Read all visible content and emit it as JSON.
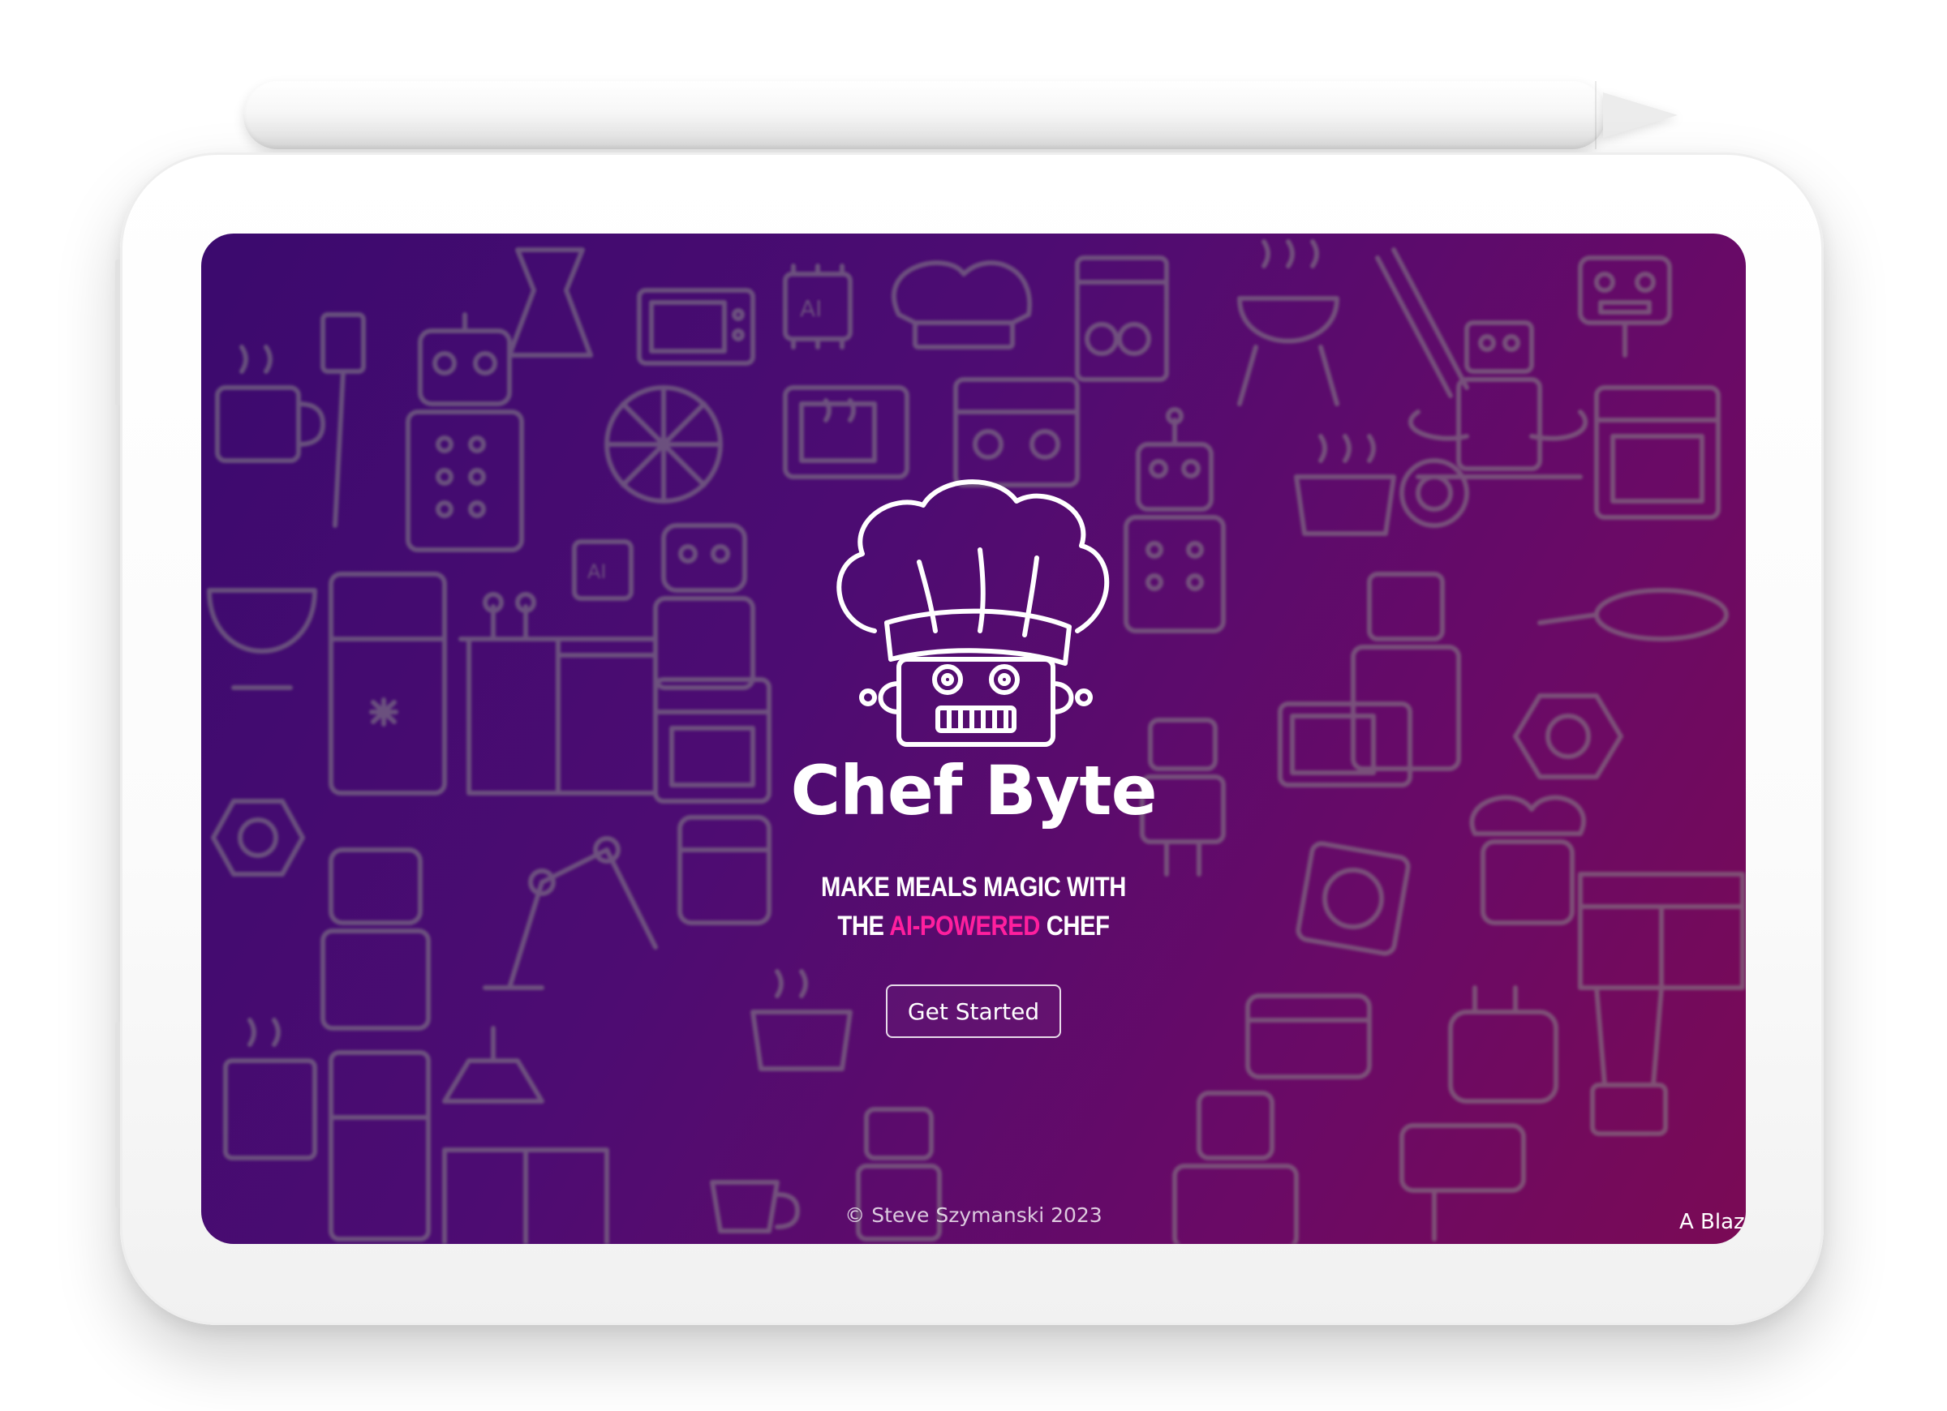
{
  "hero": {
    "app_name": "Chef Byte",
    "tagline": {
      "line1": "MAKE MEALS MAGIC WITH",
      "line2_prefix": "THE ",
      "line2_accent": "AI-POWERED",
      "line2_suffix": " CHEF"
    },
    "cta_label": "Get Started"
  },
  "footer": {
    "copyright": "© Steve Szymanski 2023",
    "credit_truncated": "A Blaz"
  },
  "icons": {
    "logo": "robot-chef-logo-icon",
    "background_pattern": "kitchen-robot-pattern"
  },
  "colors": {
    "gradient_start": "#3b0a6e",
    "gradient_end": "#7a0a55",
    "accent": "#ff1f9e",
    "text": "#ffffff",
    "pattern_line": "#8a8a8a"
  }
}
